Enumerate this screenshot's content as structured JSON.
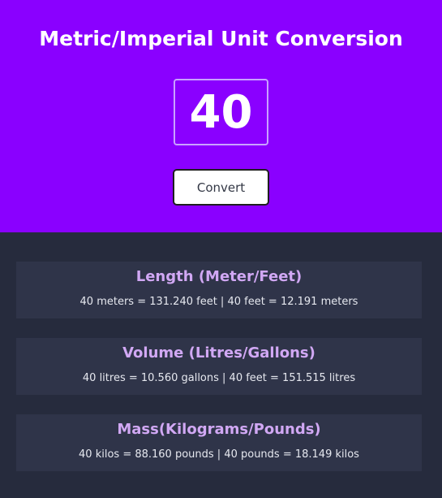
{
  "header": {
    "title": "Metric/Imperial Unit Conversion",
    "input_value": "40",
    "convert_label": "Convert"
  },
  "cards": [
    {
      "title": "Length (Meter/Feet)",
      "text": "40 meters = 131.240 feet | 40 feet = 12.191 meters"
    },
    {
      "title": "Volume (Litres/Gallons)",
      "text": "40 litres = 10.560 gallons | 40 feet = 151.515 litres"
    },
    {
      "title": "Mass(Kilograms/Pounds)",
      "text": "40 kilos = 88.160 pounds | 40 pounds = 18.149 kilos"
    }
  ],
  "colors": {
    "header_bg": "#8a00ff",
    "page_bg": "#262b3d",
    "card_bg": "#2f3449",
    "card_title": "#d1a8f4"
  }
}
